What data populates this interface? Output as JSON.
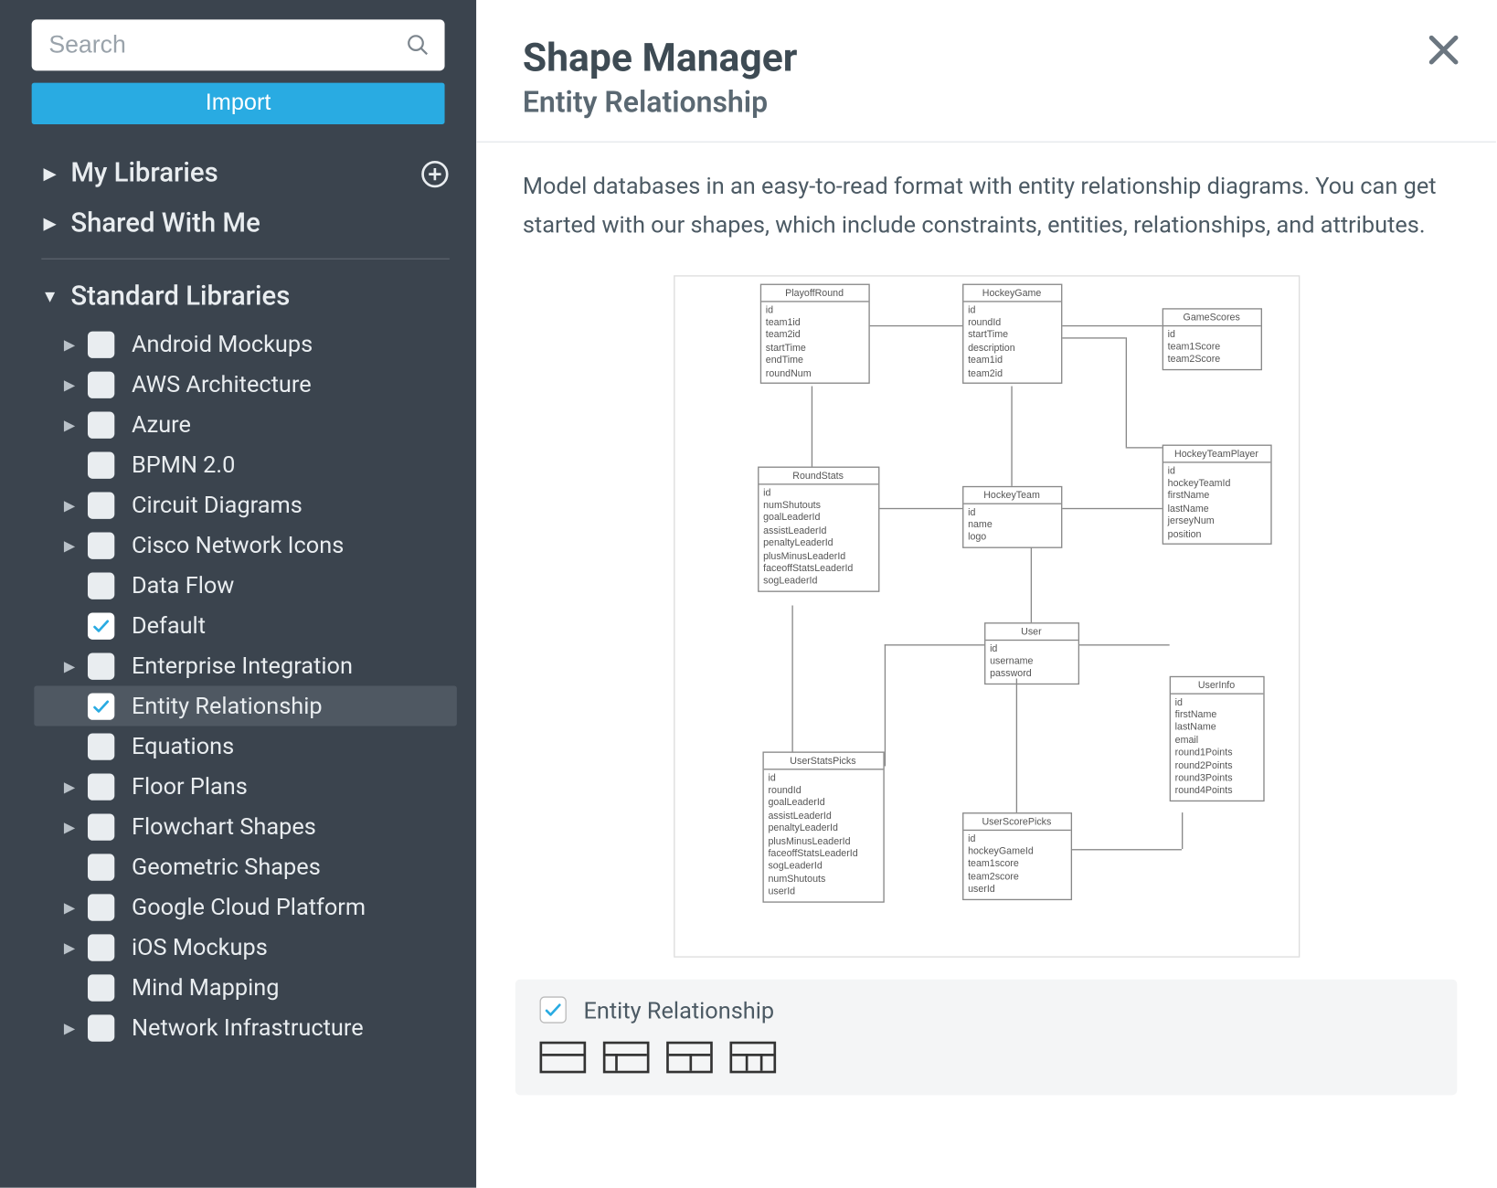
{
  "sidebar": {
    "search_placeholder": "Search",
    "import_label": "Import",
    "sections": {
      "my_libraries": "My Libraries",
      "shared_with_me": "Shared With Me",
      "standard_libraries": "Standard Libraries"
    },
    "items": [
      {
        "label": "Android Mockups",
        "has_children": true,
        "checked": false
      },
      {
        "label": "AWS Architecture",
        "has_children": true,
        "checked": false
      },
      {
        "label": "Azure",
        "has_children": true,
        "checked": false
      },
      {
        "label": "BPMN 2.0",
        "has_children": false,
        "checked": false
      },
      {
        "label": "Circuit Diagrams",
        "has_children": true,
        "checked": false
      },
      {
        "label": "Cisco Network Icons",
        "has_children": true,
        "checked": false
      },
      {
        "label": "Data Flow",
        "has_children": false,
        "checked": false
      },
      {
        "label": "Default",
        "has_children": false,
        "checked": true
      },
      {
        "label": "Enterprise Integration",
        "has_children": true,
        "checked": false
      },
      {
        "label": "Entity Relationship",
        "has_children": false,
        "checked": true,
        "selected": true
      },
      {
        "label": "Equations",
        "has_children": false,
        "checked": false
      },
      {
        "label": "Floor Plans",
        "has_children": true,
        "checked": false
      },
      {
        "label": "Flowchart Shapes",
        "has_children": true,
        "checked": false
      },
      {
        "label": "Geometric Shapes",
        "has_children": false,
        "checked": false
      },
      {
        "label": "Google Cloud Platform",
        "has_children": true,
        "checked": false
      },
      {
        "label": "iOS Mockups",
        "has_children": true,
        "checked": false
      },
      {
        "label": "Mind Mapping",
        "has_children": false,
        "checked": false
      },
      {
        "label": "Network Infrastructure",
        "has_children": true,
        "checked": false
      }
    ]
  },
  "main": {
    "title": "Shape Manager",
    "subtitle": "Entity Relationship",
    "description": "Model databases in an easy-to-read format with entity relationship diagrams. You can get started with our shapes, which include constraints, entities, relationships, and attributes.",
    "preview_entities": {
      "PlayoffRound": [
        "id",
        "team1id",
        "team2id",
        "startTime",
        "endTime",
        "roundNum"
      ],
      "HockeyGame": [
        "id",
        "roundId",
        "startTime",
        "description",
        "team1id",
        "team2id"
      ],
      "GameScores": [
        "id",
        "team1Score",
        "team2Score"
      ],
      "RoundStats": [
        "id",
        "numShutouts",
        "goalLeaderId",
        "assistLeaderId",
        "penaltyLeaderId",
        "plusMinusLeaderId",
        "faceoffStatsLeaderId",
        "sogLeaderId"
      ],
      "HockeyTeam": [
        "id",
        "name",
        "logo"
      ],
      "HockeyTeamPlayer": [
        "id",
        "hockeyTeamId",
        "firstName",
        "lastName",
        "jerseyNum",
        "position"
      ],
      "User": [
        "id",
        "username",
        "password"
      ],
      "UserInfo": [
        "id",
        "firstName",
        "lastName",
        "email",
        "round1Points",
        "round2Points",
        "round3Points",
        "round4Points"
      ],
      "UserStatsPicks": [
        "id",
        "roundId",
        "goalLeaderId",
        "assistLeaderId",
        "penaltyLeaderId",
        "plusMinusLeaderId",
        "faceoffStatsLeaderId",
        "sogLeaderId",
        "numShutouts",
        "userId"
      ],
      "UserScorePicks": [
        "id",
        "hockeyGameId",
        "team1score",
        "team2score",
        "userId"
      ]
    },
    "bottom_checkbox_label": "Entity Relationship"
  }
}
